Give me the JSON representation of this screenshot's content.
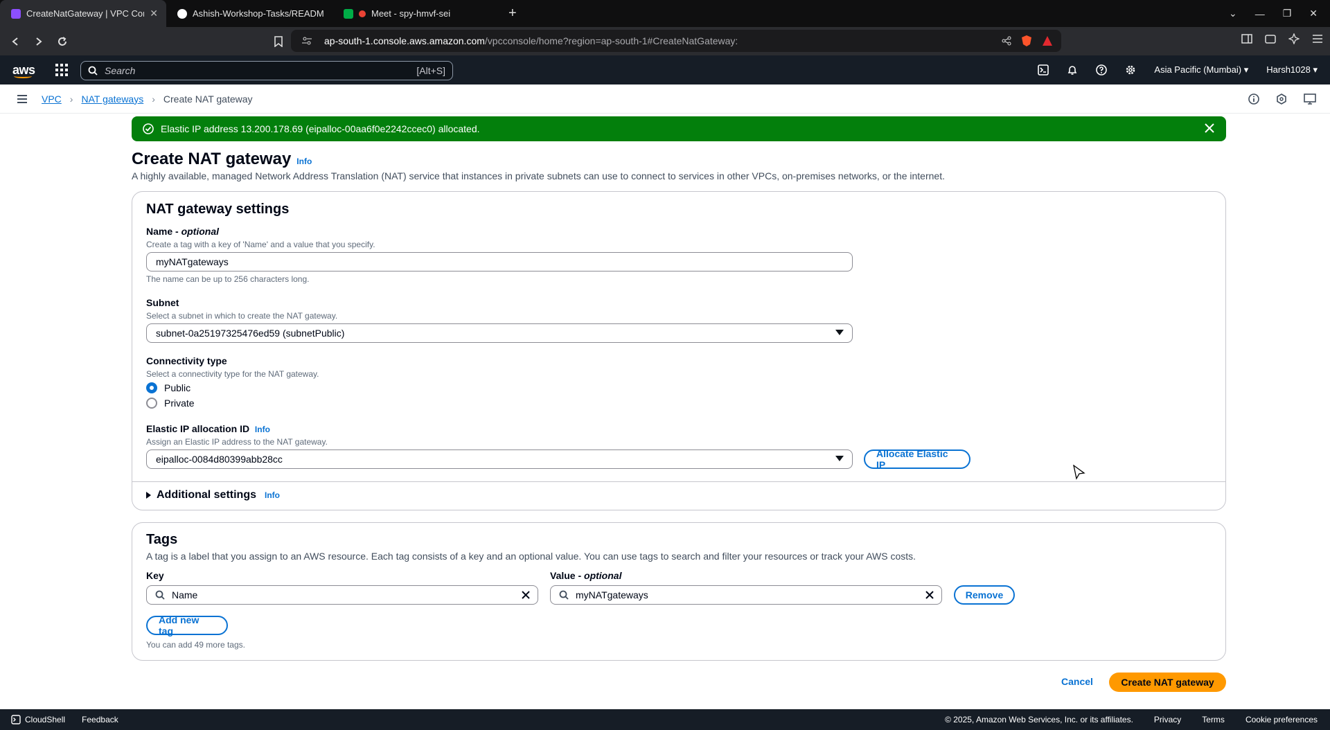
{
  "browser": {
    "tabs": [
      {
        "title": "CreateNatGateway | VPC Con",
        "active": true
      },
      {
        "title": "Ashish-Workshop-Tasks/README",
        "active": false
      },
      {
        "title": "Meet - spy-hmvf-sei",
        "active": false
      }
    ],
    "url_domain": "ap-south-1.console.aws.amazon.com",
    "url_path": "/vpcconsole/home?region=ap-south-1#CreateNatGateway:"
  },
  "aws_header": {
    "logo": "aws",
    "search_placeholder": "Search",
    "search_shortcut": "[Alt+S]",
    "region": "Asia Pacific (Mumbai)",
    "user": "Harsh1028"
  },
  "breadcrumbs": [
    "VPC",
    "NAT gateways",
    "Create NAT gateway"
  ],
  "flash": {
    "message": "Elastic IP address 13.200.178.69 (eipalloc-00aa6f0e2242ccec0) allocated.",
    "color": "#037f0c"
  },
  "page": {
    "title": "Create NAT gateway",
    "info": "Info",
    "description": "A highly available, managed Network Address Translation (NAT) service that instances in private subnets can use to connect to services in other VPCs, on-premises networks, or the internet."
  },
  "settings": {
    "heading": "NAT gateway settings",
    "name_label": "Name - ",
    "name_optional": "optional",
    "name_hint": "Create a tag with a key of 'Name' and a value that you specify.",
    "name_value": "myNATgateways",
    "name_constraint": "The name can be up to 256 characters long.",
    "subnet_label": "Subnet",
    "subnet_hint": "Select a subnet in which to create the NAT gateway.",
    "subnet_value": "subnet-0a25197325476ed59 (subnetPublic)",
    "connectivity_label": "Connectivity type",
    "connectivity_hint": "Select a connectivity type for the NAT gateway.",
    "connectivity_options": [
      "Public",
      "Private"
    ],
    "connectivity_selected": "Public",
    "eip_label": "Elastic IP allocation ID",
    "eip_info": "Info",
    "eip_hint": "Assign an Elastic IP address to the NAT gateway.",
    "eip_value": "eipalloc-0084d80399abb28cc",
    "allocate_button": "Allocate Elastic IP",
    "additional_settings": "Additional settings",
    "additional_info": "Info"
  },
  "tags": {
    "heading": "Tags",
    "description": "A tag is a label that you assign to an AWS resource. Each tag consists of a key and an optional value. You can use tags to search and filter your resources or track your AWS costs.",
    "key_label": "Key",
    "value_label": "Value - ",
    "value_optional": "optional",
    "key_value": "Name",
    "value_value": "myNATgateways",
    "remove_button": "Remove",
    "add_button": "Add new tag",
    "limit_text": "You can add 49 more tags."
  },
  "actions": {
    "cancel": "Cancel",
    "create": "Create NAT gateway",
    "primary_color": "#ff9900"
  },
  "footer": {
    "cloudshell": "CloudShell",
    "feedback": "Feedback",
    "copyright": "© 2025, Amazon Web Services, Inc. or its affiliates.",
    "links": [
      "Privacy",
      "Terms",
      "Cookie preferences"
    ]
  }
}
